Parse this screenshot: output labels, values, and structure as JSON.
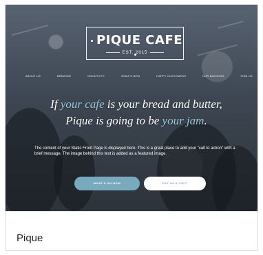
{
  "theme": {
    "name": "Pique"
  },
  "preview": {
    "logo": {
      "name": "PIQUE CAFE",
      "est": "EST. 2015"
    },
    "menu": [
      "ABOUT US",
      "BREWING",
      "CREATIVITY",
      "WHAT'S NEW",
      "HAPPY CUSTOMERS",
      "OUR BARISTAS",
      "FIND US"
    ],
    "headline": {
      "part1": "If ",
      "accent1": "your cafe",
      "part2": " is your bread and butter,",
      "part3": "Pique is going to be ",
      "accent2": "your jam",
      "part4": "."
    },
    "description": "The content of your Static Front Page is displayed here. This is a great place to add your \"call to action\" with a brief message. The image behind this text is added as a featured image.",
    "buttons": {
      "primary": "WHAT'S ON NOW",
      "secondary": "PAY US A VISIT"
    }
  },
  "colors": {
    "accent": "#79a9bd",
    "text": "#1d2327",
    "border": "#dcdcde"
  }
}
